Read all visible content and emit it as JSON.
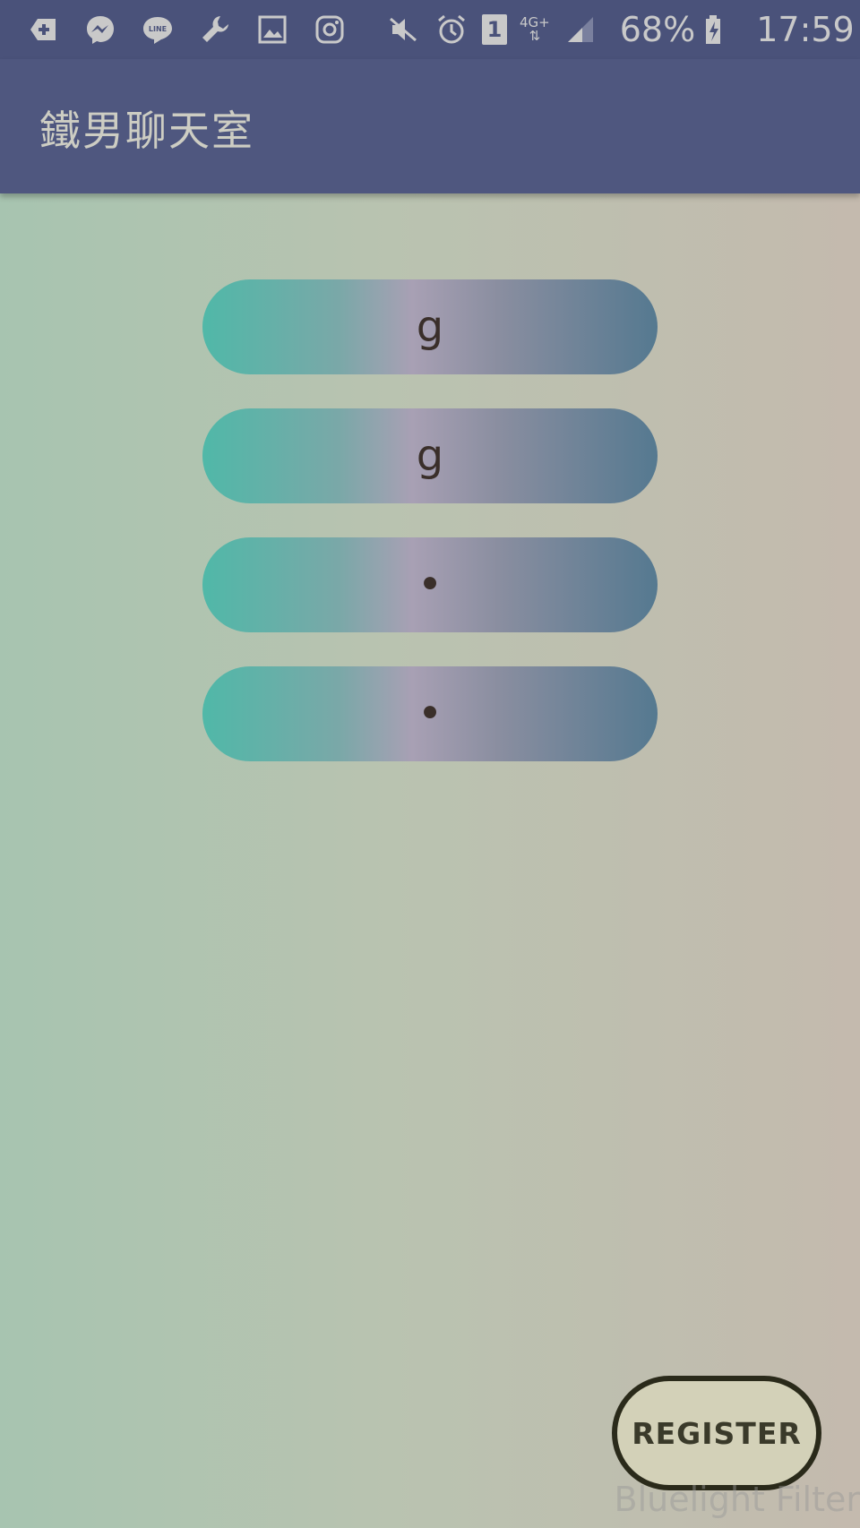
{
  "status_bar": {
    "left_icons": [
      "plus-badge-icon",
      "messenger-icon",
      "line-icon",
      "wrench-icon",
      "image-icon",
      "instagram-icon"
    ],
    "right_icons": [
      "mute-icon",
      "alarm-icon",
      "sim-icon",
      "signal-icon",
      "battery-charging-icon"
    ],
    "sim_slot": "1",
    "network_type": "4G+",
    "network_arrows": "⇅",
    "battery_percent": "68%",
    "time": "17:59",
    "colors": {
      "background": "#4a527a",
      "foreground": "#c9c9c9"
    }
  },
  "app_bar": {
    "title": "鐵男聊天室",
    "color": "#4f577f"
  },
  "form": {
    "field_1_value": "g",
    "field_2_value": "g",
    "field_3_value": "•",
    "field_4_value": "•",
    "pill_gradient": [
      "#50b8a8",
      "#a8a0b4",
      "#557990"
    ]
  },
  "register_button": {
    "label": "REGISTER"
  },
  "overlay": {
    "watermark": "Bluelight Filter"
  }
}
